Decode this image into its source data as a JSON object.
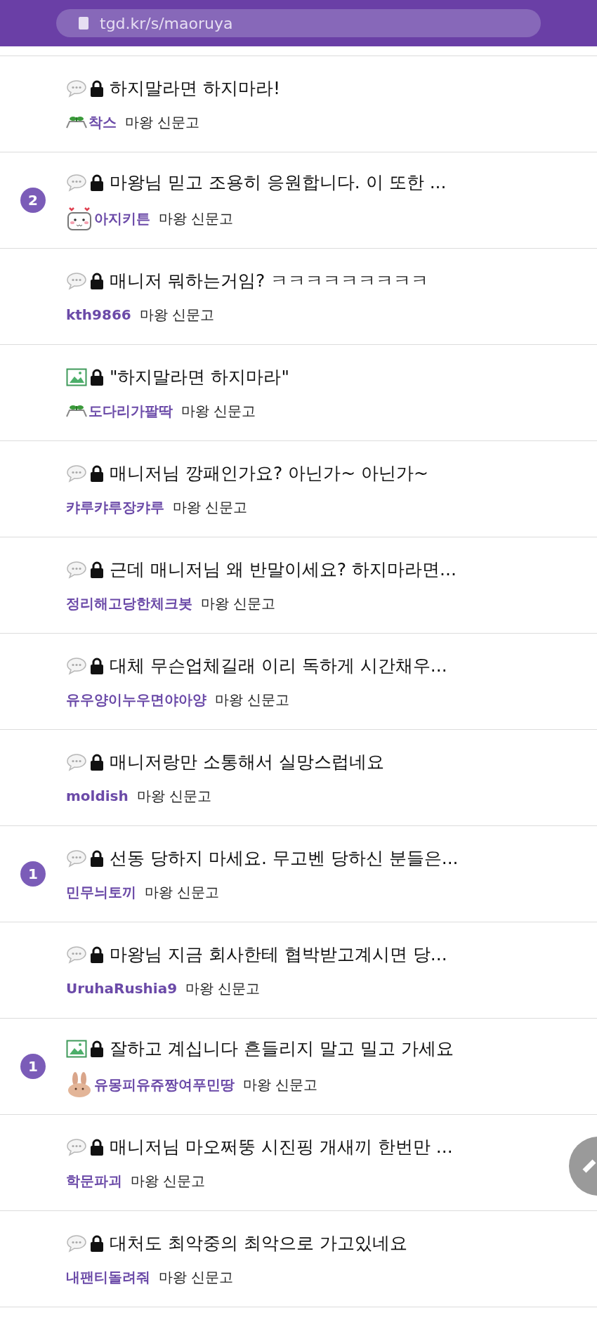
{
  "address_bar": {
    "url": "tgd.kr/s/maoruya"
  },
  "posts": [
    {
      "kind": "comment",
      "locked": true,
      "title": "하지말라면 하지마라!",
      "avatar": {
        "kind": "sprout"
      },
      "author": "착스",
      "category": "마왕 신문고"
    },
    {
      "kind": "comment",
      "locked": true,
      "title": "마왕님 믿고 조용히 응원합니다. 이 또한 ...",
      "avatar": {
        "kind": "cat"
      },
      "author": "아지키튼",
      "category": "마왕 신문고",
      "badge": "2"
    },
    {
      "kind": "comment",
      "locked": true,
      "title": "매니저 뭐하는거임? ㅋㅋㅋㅋㅋㅋㅋㅋㅋ",
      "author": "kth9866",
      "category": "마왕 신문고"
    },
    {
      "kind": "image",
      "locked": true,
      "title": "\"하지말라면 하지마라\"",
      "avatar": {
        "kind": "sprout"
      },
      "author": "도다리가팔딱",
      "category": "마왕 신문고"
    },
    {
      "kind": "comment",
      "locked": true,
      "title": "매니저님 깡패인가요? 아닌가~ 아닌가~",
      "author": "캬루캬루장캬루",
      "category": "마왕 신문고"
    },
    {
      "kind": "comment",
      "locked": true,
      "title": "근데 매니저님 왜 반말이세요? 하지마라면...",
      "author": "정리해고당한체크봇",
      "category": "마왕 신문고"
    },
    {
      "kind": "comment",
      "locked": true,
      "title": "대체 무슨업체길래 이리 독하게 시간채우...",
      "author": "유우양이누우면야아양",
      "category": "마왕 신문고"
    },
    {
      "kind": "comment",
      "locked": true,
      "title": "매니저랑만 소통해서 실망스럽네요",
      "author": "moldish",
      "category": "마왕 신문고"
    },
    {
      "kind": "comment",
      "locked": true,
      "title": "선동 당하지 마세요. 무고벤 당하신 분들은...",
      "author": "민무늬토끼",
      "category": "마왕 신문고",
      "badge": "1"
    },
    {
      "kind": "comment",
      "locked": true,
      "title": "마왕님 지금 회사한테 협박받고계시면 당...",
      "author": "UruhaRushia9",
      "category": "마왕 신문고"
    },
    {
      "kind": "image",
      "locked": true,
      "title": "잘하고 계십니다 흔들리지 말고 밀고 가세요",
      "avatar": {
        "kind": "bunny"
      },
      "author": "유몽피유쥬짱여푸민땅",
      "category": "마왕 신문고",
      "badge": "1"
    },
    {
      "kind": "comment",
      "locked": true,
      "title": "매니저님 마오쩌뚱 시진핑 개새끼 한번만 ...",
      "author": "학문파괴",
      "category": "마왕 신문고"
    },
    {
      "kind": "comment",
      "locked": true,
      "title": "대처도 최악중의 최악으로 가고있네요",
      "author": "내팬티돌려줘",
      "category": "마왕 신문고"
    }
  ]
}
